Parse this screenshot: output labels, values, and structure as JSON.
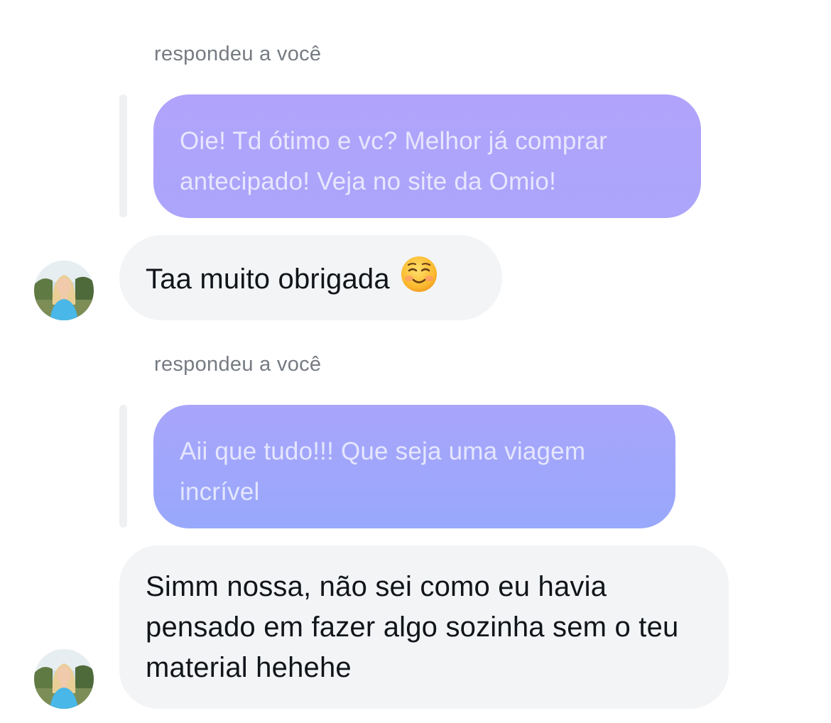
{
  "thread": {
    "items": [
      {
        "reply_label": "respondeu a você",
        "quoted_text": "Oie! Td ótimo e vc? Melhor já comprar antecipado! Veja no site da Omio!",
        "reply_text": "Taa muito obrigada",
        "reply_emoji": "smiling-face-icon"
      },
      {
        "reply_label": "respondeu a você",
        "quoted_text": "Aii que tudo!!! Que seja uma viagem incrível",
        "reply_text": "Simm nossa, não sei como eu havia pensado em fazer algo sozinha sem o teu material hehehe"
      }
    ]
  },
  "colors": {
    "quoted_gradient_top": "#b1a3fb",
    "quoted_gradient_bottom": "#98a8fb",
    "incoming_bubble": "#f2f4f6",
    "meta_text": "#767b82"
  }
}
